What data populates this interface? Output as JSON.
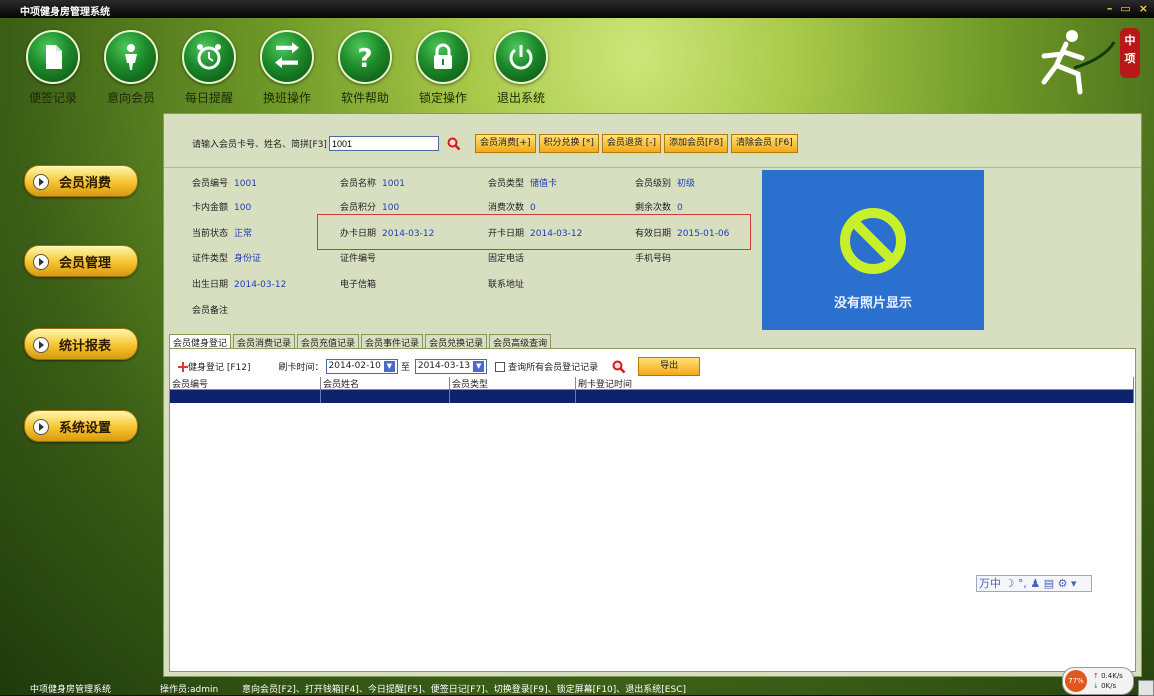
{
  "window": {
    "title": "中项健身房管理系统",
    "min": "–",
    "restore": "▭",
    "close": "×"
  },
  "toolbar": [
    {
      "label": "便签记录",
      "icon": "note-icon"
    },
    {
      "label": "意向会员",
      "icon": "member-icon"
    },
    {
      "label": "每日提醒",
      "icon": "alarm-clock-icon"
    },
    {
      "label": "换班操作",
      "icon": "swap-arrows-icon"
    },
    {
      "label": "软件帮助",
      "icon": "help-icon"
    },
    {
      "label": "锁定操作",
      "icon": "lock-icon"
    },
    {
      "label": "退出系统",
      "icon": "power-icon"
    }
  ],
  "logo": {
    "seal_text": "中项"
  },
  "sidebar": [
    {
      "label": "会员消费"
    },
    {
      "label": "会员管理"
    },
    {
      "label": "统计报表"
    },
    {
      "label": "系统设置"
    }
  ],
  "search": {
    "label": "请输入会员卡号、姓名、简拼[F3]",
    "value": "1001",
    "buttons": [
      "会员消费[+]",
      "积分兑换 [*]",
      "会员退货 [-]",
      "添加会员[F8]",
      "清除会员 [F6]"
    ]
  },
  "member": {
    "id_label": "会员编号",
    "id": "1001",
    "name_label": "会员名称",
    "name": "1001",
    "type_label": "会员类型",
    "type": "储值卡",
    "level_label": "会员级别",
    "level": "初级",
    "balance_label": "卡内金额",
    "balance": "100",
    "points_label": "会员积分",
    "points": "100",
    "consume_count_label": "消费次数",
    "consume_count": "0",
    "remain_count_label": "剩余次数",
    "remain_count": "0",
    "status_label": "当前状态",
    "status": "正常",
    "issue_date_label": "办卡日期",
    "issue_date": "2014-03-12",
    "open_date_label": "开卡日期",
    "open_date": "2014-03-12",
    "expire_date_label": "有效日期",
    "expire_date": "2015-01-06",
    "cert_type_label": "证件类型",
    "cert_type": "身份证",
    "cert_no_label": "证件编号",
    "phone_label": "固定电话",
    "mobile_label": "手机号码",
    "birthday_label": "出生日期",
    "birthday": "2014-03-12",
    "email_label": "电子信箱",
    "address_label": "联系地址",
    "note_label": "会员备注",
    "photo_text": "没有照片显示"
  },
  "tabs": [
    "会员健身登记",
    "会员消费记录",
    "会员充值记录",
    "会员事件记录",
    "会员兑换记录",
    "会员高级查询"
  ],
  "checkin": {
    "add_label": "健身登记 [F12]",
    "time_label": "刷卡时间：",
    "from": "2014-02-10",
    "to_label": "至",
    "to": "2014-03-13",
    "all_label": "查询所有会员登记记录",
    "export_label": "导出",
    "columns": [
      "会员编号",
      "会员姓名",
      "会员类型",
      "刷卡登记时间"
    ]
  },
  "ime": "万中 ☽ °, ♟ ▤ ⚙ ▾",
  "status": {
    "app": "中项健身房管理系统",
    "operator": "操作员:admin",
    "shortcuts": "意向会员[F2]、打开钱箱[F4]、今日提醒[F5]、便签日记[F7]、切换登录[F9]、锁定屏幕[F10]、退出系统[ESC]"
  },
  "net": {
    "cpu": "77%",
    "up": "0.4K/s",
    "down": "0K/s"
  },
  "colors": {
    "accent": "#f3a818",
    "value_blue": "#1f3fb6",
    "photo_bg": "#2b6fcf",
    "highlight_row": "#0c246b"
  }
}
